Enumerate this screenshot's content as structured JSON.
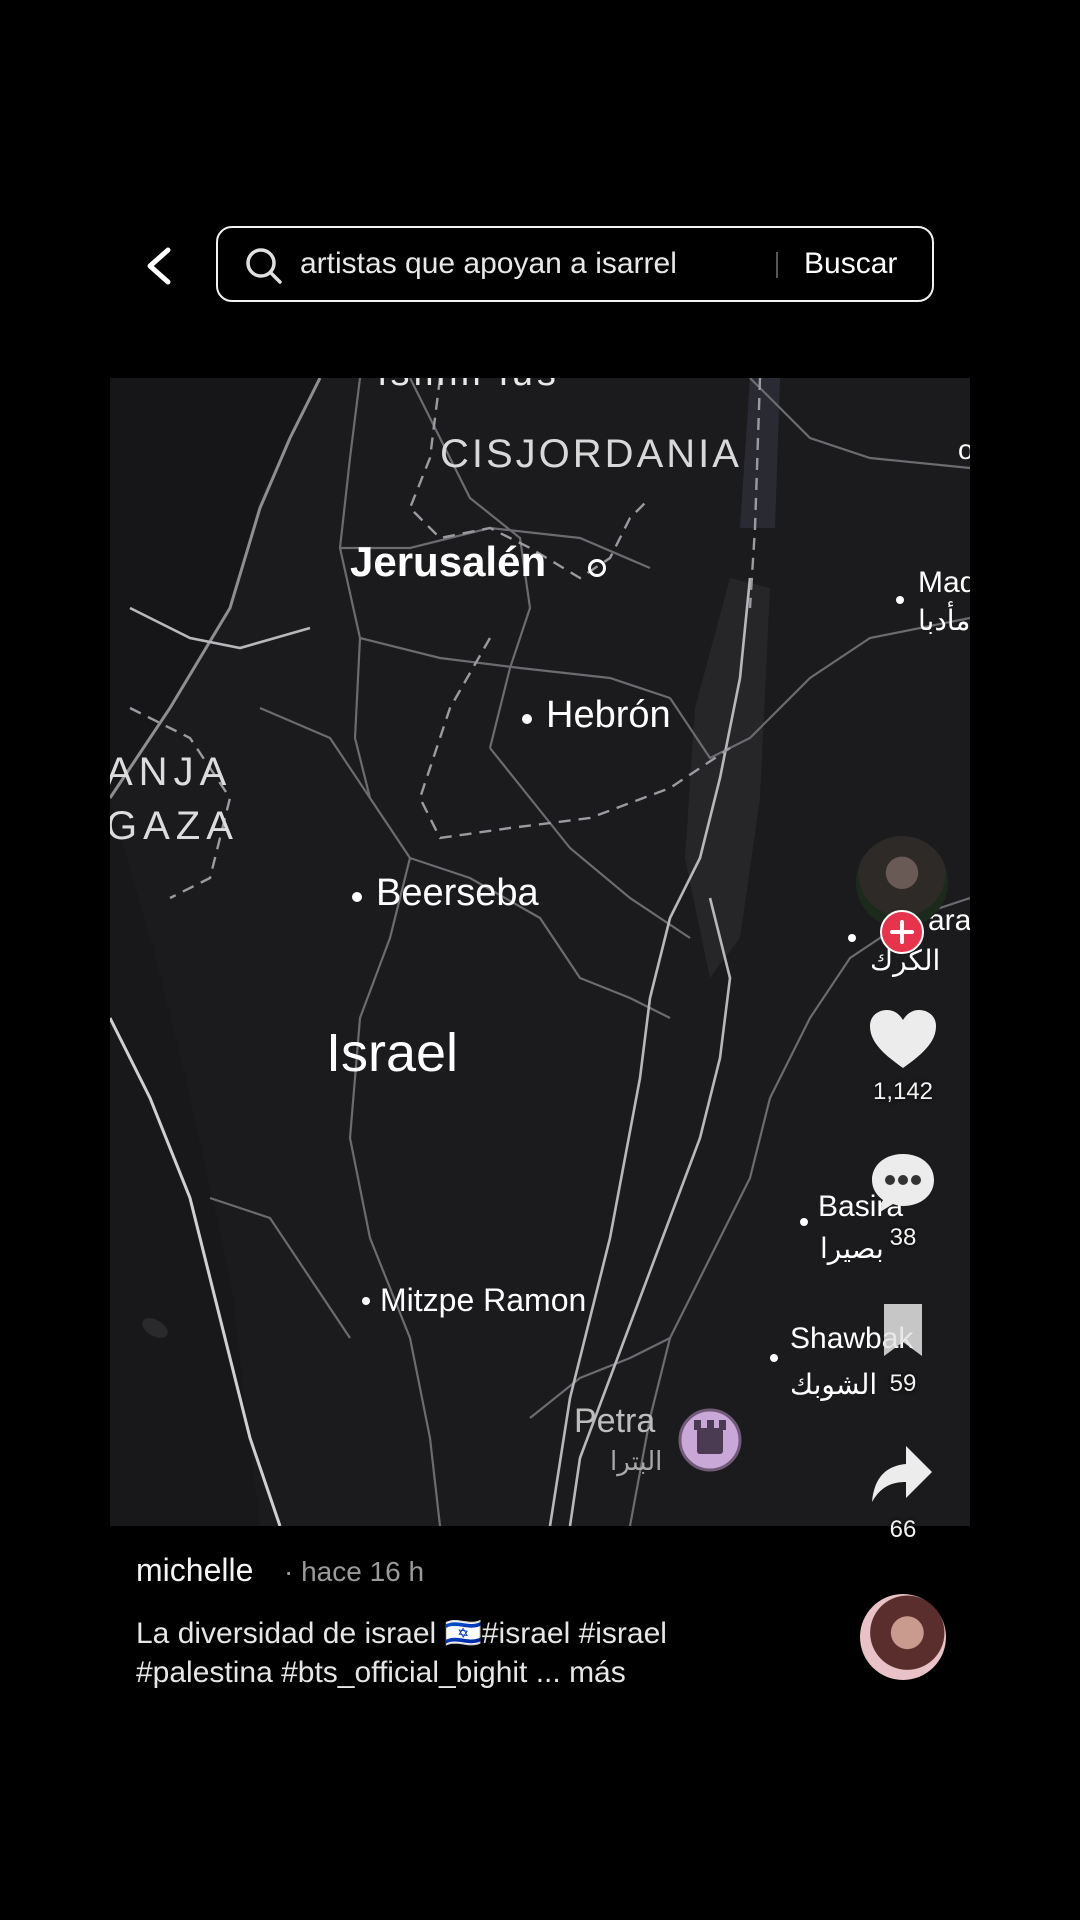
{
  "search": {
    "query": "artistas que apoyan a isarrel",
    "button_label": "Buscar"
  },
  "map": {
    "labels": {
      "top_cut": "ismm  ius",
      "west_bank": "CISJORDANIA",
      "jerusalem": "Jerusalén",
      "hebron": "Hebrón",
      "gaza_line1": "ANJA",
      "gaza_line2": "GAZA",
      "beersheba": "Beerseba",
      "country": "Israel",
      "mitzpe": "Mitzpe Ramon",
      "petra": "Petra",
      "petra_ar": "البترا",
      "madaba": "Mad",
      "madaba_ar": "مأدبا",
      "karak": "ara",
      "karak_ar": "الكرك",
      "basira": "Basira",
      "basira_ar": "بصيرا",
      "shawbak": "Shawbak",
      "shawbak_ar": "الشوبك",
      "edge_o": "o"
    }
  },
  "actions": {
    "likes": "1,142",
    "comments": "38",
    "saves": "59",
    "shares": "66"
  },
  "post": {
    "username": "michelle",
    "time": "· hace 16 h",
    "caption_line1": "La diversidad de israel 🇮🇱#israel #israel",
    "caption_line2": "#palestina #bts_official_bighit ... más"
  },
  "colors": {
    "follow_plus": "#e8334c",
    "map_bg": "#1b1b1d",
    "petra_pin": "#c9a7d6"
  }
}
